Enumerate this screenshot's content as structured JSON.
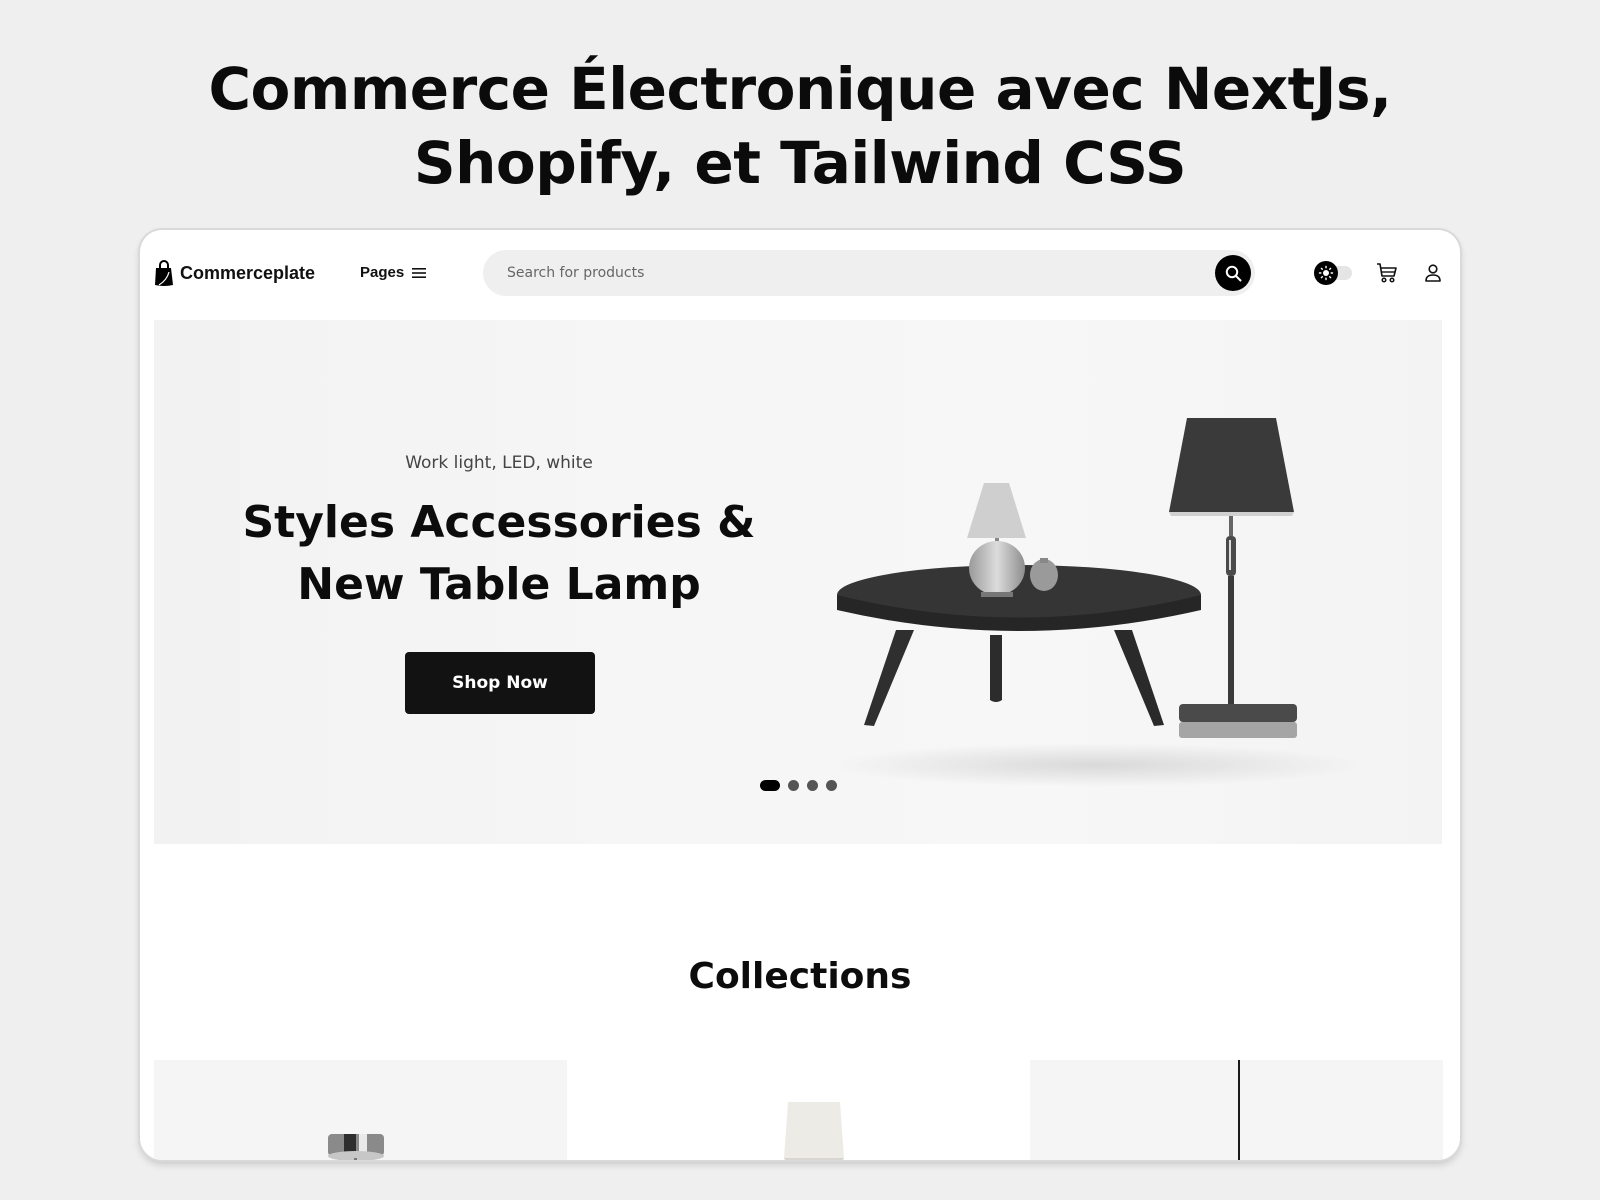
{
  "headline": {
    "line1": "Commerce Électronique avec NextJs,",
    "line2": "Shopify, et Tailwind CSS"
  },
  "nav": {
    "brand": "Commerceplate",
    "brand_icon": "shopping-bag-icon",
    "pages_label": "Pages",
    "pages_icon": "menu-icon",
    "search_placeholder": "Search for products",
    "search_icon": "search-icon",
    "theme_toggle_icon": "sun-icon",
    "cart_icon": "cart-icon",
    "user_icon": "user-icon"
  },
  "hero": {
    "subtitle": "Work light, LED, white",
    "title_line1": "Styles Accessories &",
    "title_line2": "New Table Lamp",
    "cta_label": "Shop Now",
    "slides_total": 4,
    "active_slide": 1
  },
  "collections": {
    "title": "Collections",
    "cards": [
      {
        "image": "pendant-lamp-chrome"
      },
      {
        "image": "white-table-lamp"
      },
      {
        "image": "hanging-cord-lamp"
      }
    ]
  }
}
